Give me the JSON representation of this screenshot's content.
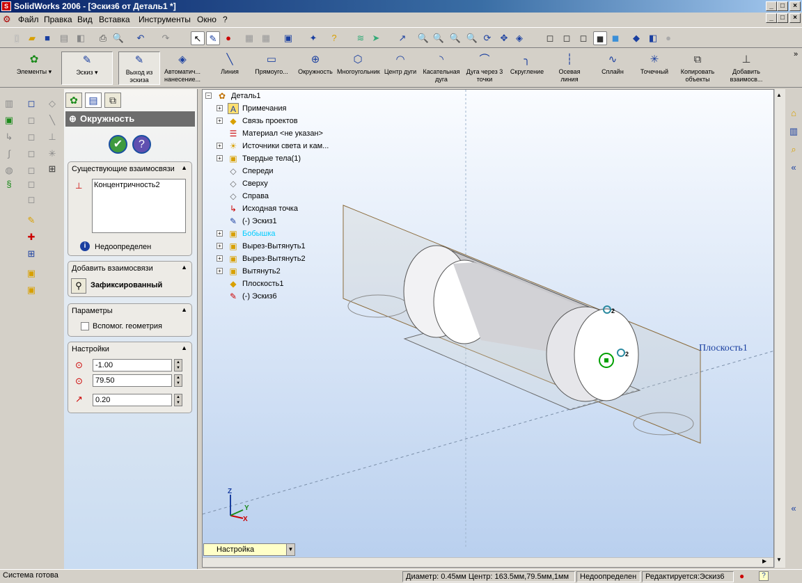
{
  "window": {
    "title": "SolidWorks 2006 - [Эскиз6 от Деталь1 *]"
  },
  "menu": [
    "Файл",
    "Правка",
    "Вид",
    "Вставка",
    "Инструменты",
    "Окно",
    "?"
  ],
  "command_manager": {
    "elements": "Элементы",
    "sketch": "Эскиз",
    "buttons": [
      "Выход из эскиза",
      "Автоматич... нанесение...",
      "Линия",
      "Прямоуго...",
      "Окружность",
      "Многоугольник",
      "Центр дуги",
      "Касательная дуга",
      "Дуга через 3 точки",
      "Скругление",
      "Осевая линия",
      "Сплайн",
      "Точечный",
      "Копировать объекты",
      "Добавить взаимосв..."
    ]
  },
  "pm": {
    "title": "Окружность",
    "existing": {
      "header": "Существующие взаимосвязи",
      "items": [
        "Концентричность2"
      ],
      "status": "Недоопределен"
    },
    "add": {
      "header": "Добавить взаимосвязи",
      "item": "Зафиксированный"
    },
    "params": {
      "header": "Параметры",
      "checkbox": "Вспомог. геометрия"
    },
    "settings": {
      "header": "Настройки",
      "x": "-1.00",
      "y": "79.50",
      "r": "0.20"
    }
  },
  "tree": {
    "root": "Деталь1",
    "items": [
      "Примечания",
      "Связь проектов",
      "Материал <не указан>",
      "Источники света и кам...",
      "Твердые тела(1)",
      "Спереди",
      "Сверху",
      "Справа",
      "Исходная точка",
      "(-) Эскиз1",
      "Бобышка",
      "Вырез-Вытянуть1",
      "Вырез-Вытянуть2",
      "Вытянуть2",
      "Плоскость1",
      "(-) Эскиз6"
    ]
  },
  "viewport": {
    "plane_label": "Плоскость1",
    "axes": {
      "x": "X",
      "y": "Y",
      "z": "Z"
    },
    "dim_2a": "2",
    "dim_2b": "2",
    "config": "Настройка"
  },
  "status": {
    "ready": "Система готова",
    "measure": "Диаметр: 0.45мм  Центр: 163.5мм,79.5мм,1мм",
    "defined": "Недоопределен",
    "editing": "Редактируется:Эскиз6"
  },
  "colors": {
    "title_bar": "#0a246a",
    "viewport_top": "#fafcff",
    "viewport_bottom": "#b8cfee",
    "sketch_green": "#00a000"
  }
}
